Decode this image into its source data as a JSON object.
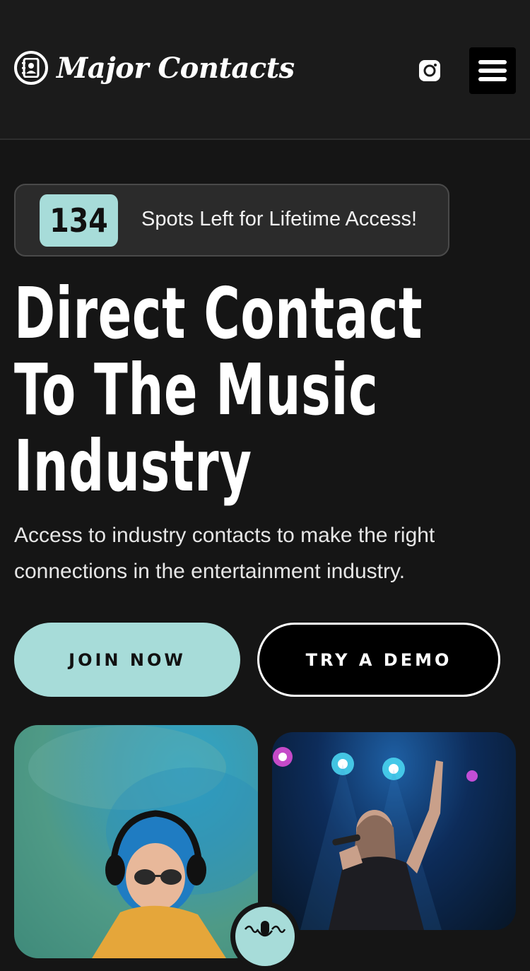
{
  "brand": {
    "name": "Major Contacts"
  },
  "header": {
    "social_icon": "instagram-icon",
    "menu_icon": "hamburger-menu-icon"
  },
  "spots": {
    "count": "134",
    "label": "Spots Left for Lifetime Access!"
  },
  "hero": {
    "title_lines": [
      "Direct Contact",
      "To The Music",
      "Industry"
    ],
    "subtitle": "Access to industry contacts to make the right connections in the entertainment industry."
  },
  "buttons": {
    "join": "JOIN NOW",
    "demo": "TRY A DEMO"
  },
  "images": {
    "left": "photo of a smiling woman with blue hair wearing headphones and sunglasses in teal smoke",
    "right": "photo of a singer performing on stage with a microphone under blue spotlights"
  },
  "colors": {
    "accent": "#a7dcd9",
    "background": "#151515",
    "header": "#1b1b1b"
  }
}
